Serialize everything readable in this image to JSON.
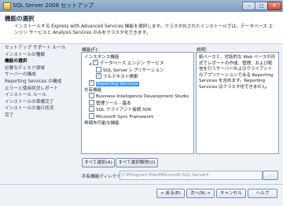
{
  "window": {
    "title": "SQL Server 2008 セットアップ",
    "minimize": "–",
    "maximize": "□",
    "close": "✕"
  },
  "header": {
    "title": "機能の選択",
    "description": "インストールする Express with Advanced Services 機能を選択します。クラスタ化されたインストールでは、データベース エンジン サービスと Analysis Services のみをクラスタ化できます。"
  },
  "sidebar": {
    "items": [
      "セットアップ サポート ルール",
      "インストールの種類",
      "機能の選択",
      "必要なディスク領域",
      "サーバーの構成",
      "Reporting Services の構成",
      "エラーと使用状況レポート",
      "インストール ルール",
      "インストールの準備完了",
      "インストールの進行状況",
      "完了"
    ],
    "active_index": 2
  },
  "features": {
    "label": "機能(F):",
    "items": [
      {
        "label": "インスタンス機能",
        "level": 0,
        "type": "group"
      },
      {
        "label": "データベース エンジン サービス",
        "level": 1,
        "type": "check",
        "checked": true,
        "expander": "◢"
      },
      {
        "label": "SQL Server レプリケーション",
        "level": 2,
        "type": "check",
        "checked": false
      },
      {
        "label": "フルテキスト検索",
        "level": 2,
        "type": "check",
        "checked": true
      },
      {
        "label": "Reporting Services",
        "level": 1,
        "type": "check",
        "checked": true,
        "selected": true
      },
      {
        "label": "共有機能",
        "level": 0,
        "type": "group"
      },
      {
        "label": "Business Intelligence Development Studio",
        "level": 1,
        "type": "check",
        "checked": false
      },
      {
        "label": "管理ツール - 基本",
        "level": 1,
        "type": "check",
        "checked": false
      },
      {
        "label": "SQL クライアント接続 SDK",
        "level": 1,
        "type": "check",
        "checked": false
      },
      {
        "label": "Microsoft Sync Framework",
        "level": 1,
        "type": "check",
        "checked": false
      },
      {
        "label": "再頒布可能な機能",
        "level": 0,
        "type": "group"
      }
    ]
  },
  "description": {
    "label": "説明:",
    "text": "紙ベースと、対話的な Web ベースの形式でレポートの作成、管理、および配信を行うサーバーおよびクライアントのアプリケーションである Reporting Services を含めます。Reporting Services はクラスタ化できません。"
  },
  "buttons": {
    "select_all": "すべて選択(A)",
    "unselect_all": "すべて選択解除(U)",
    "back": "< 戻る(B)",
    "next": "次へ(N) >",
    "cancel": "キャンセル",
    "help": "ヘルプ"
  },
  "shared_dir": {
    "label": "共有機能ディレクトリ(S):",
    "value": "C:¥Program Files¥Microsoft SQL Server¥",
    "browse": "..."
  },
  "colors": {
    "selection": "#3399ff",
    "titlebar": "#8fabcc",
    "panel": "#eef2f7"
  },
  "icons": {
    "window": "sql-setup-icon",
    "check": "✓"
  }
}
